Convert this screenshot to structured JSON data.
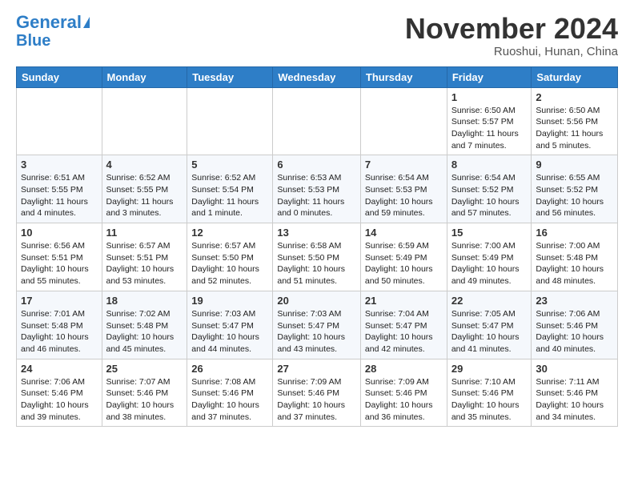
{
  "header": {
    "logo_line1": "General",
    "logo_line2": "Blue",
    "month": "November 2024",
    "location": "Ruoshui, Hunan, China"
  },
  "weekdays": [
    "Sunday",
    "Monday",
    "Tuesday",
    "Wednesday",
    "Thursday",
    "Friday",
    "Saturday"
  ],
  "weeks": [
    [
      {
        "day": "",
        "info": ""
      },
      {
        "day": "",
        "info": ""
      },
      {
        "day": "",
        "info": ""
      },
      {
        "day": "",
        "info": ""
      },
      {
        "day": "",
        "info": ""
      },
      {
        "day": "1",
        "info": "Sunrise: 6:50 AM\nSunset: 5:57 PM\nDaylight: 11 hours\nand 7 minutes."
      },
      {
        "day": "2",
        "info": "Sunrise: 6:50 AM\nSunset: 5:56 PM\nDaylight: 11 hours\nand 5 minutes."
      }
    ],
    [
      {
        "day": "3",
        "info": "Sunrise: 6:51 AM\nSunset: 5:55 PM\nDaylight: 11 hours\nand 4 minutes."
      },
      {
        "day": "4",
        "info": "Sunrise: 6:52 AM\nSunset: 5:55 PM\nDaylight: 11 hours\nand 3 minutes."
      },
      {
        "day": "5",
        "info": "Sunrise: 6:52 AM\nSunset: 5:54 PM\nDaylight: 11 hours\nand 1 minute."
      },
      {
        "day": "6",
        "info": "Sunrise: 6:53 AM\nSunset: 5:53 PM\nDaylight: 11 hours\nand 0 minutes."
      },
      {
        "day": "7",
        "info": "Sunrise: 6:54 AM\nSunset: 5:53 PM\nDaylight: 10 hours\nand 59 minutes."
      },
      {
        "day": "8",
        "info": "Sunrise: 6:54 AM\nSunset: 5:52 PM\nDaylight: 10 hours\nand 57 minutes."
      },
      {
        "day": "9",
        "info": "Sunrise: 6:55 AM\nSunset: 5:52 PM\nDaylight: 10 hours\nand 56 minutes."
      }
    ],
    [
      {
        "day": "10",
        "info": "Sunrise: 6:56 AM\nSunset: 5:51 PM\nDaylight: 10 hours\nand 55 minutes."
      },
      {
        "day": "11",
        "info": "Sunrise: 6:57 AM\nSunset: 5:51 PM\nDaylight: 10 hours\nand 53 minutes."
      },
      {
        "day": "12",
        "info": "Sunrise: 6:57 AM\nSunset: 5:50 PM\nDaylight: 10 hours\nand 52 minutes."
      },
      {
        "day": "13",
        "info": "Sunrise: 6:58 AM\nSunset: 5:50 PM\nDaylight: 10 hours\nand 51 minutes."
      },
      {
        "day": "14",
        "info": "Sunrise: 6:59 AM\nSunset: 5:49 PM\nDaylight: 10 hours\nand 50 minutes."
      },
      {
        "day": "15",
        "info": "Sunrise: 7:00 AM\nSunset: 5:49 PM\nDaylight: 10 hours\nand 49 minutes."
      },
      {
        "day": "16",
        "info": "Sunrise: 7:00 AM\nSunset: 5:48 PM\nDaylight: 10 hours\nand 48 minutes."
      }
    ],
    [
      {
        "day": "17",
        "info": "Sunrise: 7:01 AM\nSunset: 5:48 PM\nDaylight: 10 hours\nand 46 minutes."
      },
      {
        "day": "18",
        "info": "Sunrise: 7:02 AM\nSunset: 5:48 PM\nDaylight: 10 hours\nand 45 minutes."
      },
      {
        "day": "19",
        "info": "Sunrise: 7:03 AM\nSunset: 5:47 PM\nDaylight: 10 hours\nand 44 minutes."
      },
      {
        "day": "20",
        "info": "Sunrise: 7:03 AM\nSunset: 5:47 PM\nDaylight: 10 hours\nand 43 minutes."
      },
      {
        "day": "21",
        "info": "Sunrise: 7:04 AM\nSunset: 5:47 PM\nDaylight: 10 hours\nand 42 minutes."
      },
      {
        "day": "22",
        "info": "Sunrise: 7:05 AM\nSunset: 5:47 PM\nDaylight: 10 hours\nand 41 minutes."
      },
      {
        "day": "23",
        "info": "Sunrise: 7:06 AM\nSunset: 5:46 PM\nDaylight: 10 hours\nand 40 minutes."
      }
    ],
    [
      {
        "day": "24",
        "info": "Sunrise: 7:06 AM\nSunset: 5:46 PM\nDaylight: 10 hours\nand 39 minutes."
      },
      {
        "day": "25",
        "info": "Sunrise: 7:07 AM\nSunset: 5:46 PM\nDaylight: 10 hours\nand 38 minutes."
      },
      {
        "day": "26",
        "info": "Sunrise: 7:08 AM\nSunset: 5:46 PM\nDaylight: 10 hours\nand 37 minutes."
      },
      {
        "day": "27",
        "info": "Sunrise: 7:09 AM\nSunset: 5:46 PM\nDaylight: 10 hours\nand 37 minutes."
      },
      {
        "day": "28",
        "info": "Sunrise: 7:09 AM\nSunset: 5:46 PM\nDaylight: 10 hours\nand 36 minutes."
      },
      {
        "day": "29",
        "info": "Sunrise: 7:10 AM\nSunset: 5:46 PM\nDaylight: 10 hours\nand 35 minutes."
      },
      {
        "day": "30",
        "info": "Sunrise: 7:11 AM\nSunset: 5:46 PM\nDaylight: 10 hours\nand 34 minutes."
      }
    ]
  ]
}
